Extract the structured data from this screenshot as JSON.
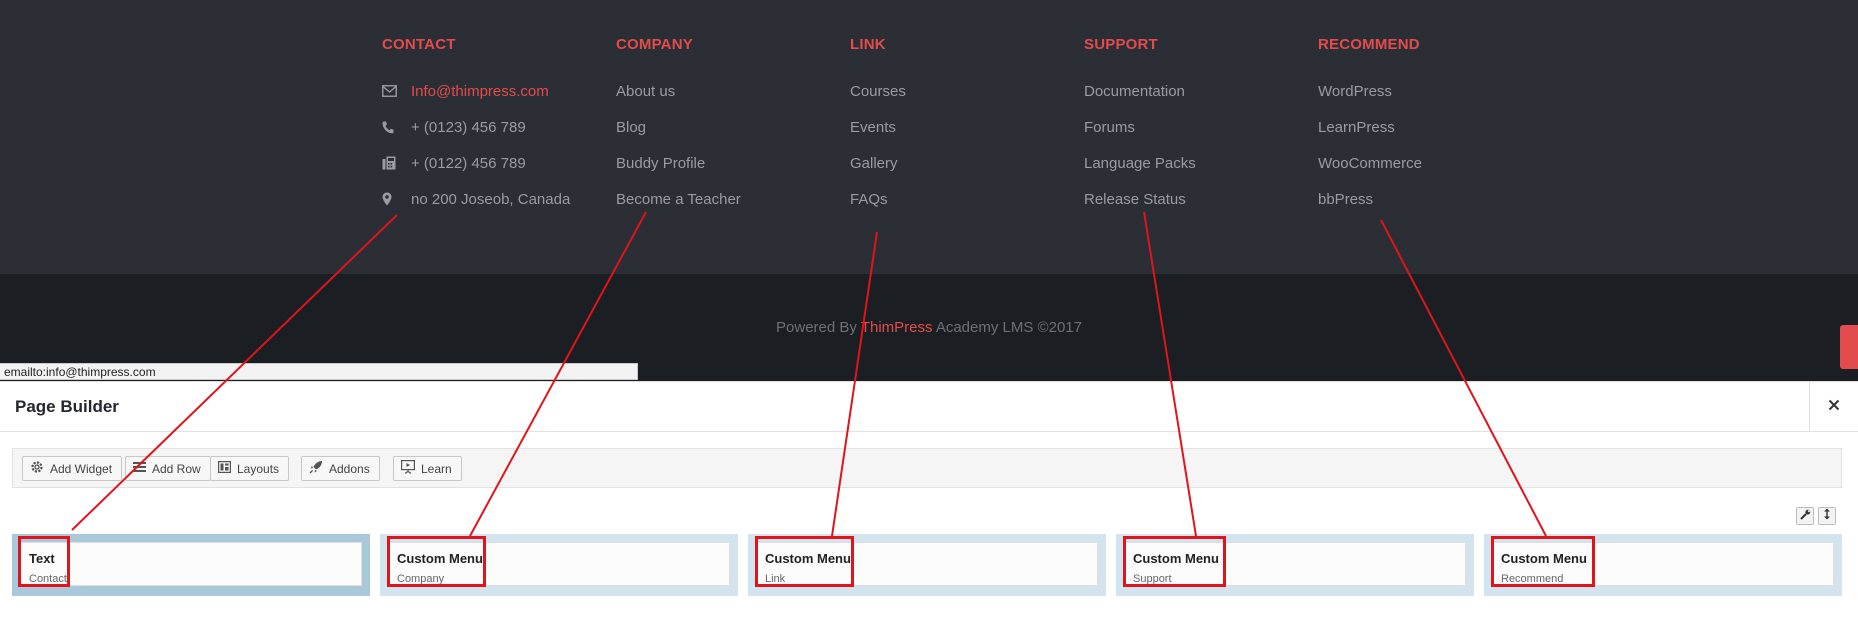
{
  "footer": {
    "columns": [
      {
        "heading": "CONTACT",
        "items": [
          {
            "label": "Info@thimpress.com",
            "icon": "envelope-icon",
            "accent": true
          },
          {
            "label": "+ (0123) 456 789",
            "icon": "phone-icon"
          },
          {
            "label": "+ (0122) 456 789",
            "icon": "fax-icon"
          },
          {
            "label": "no 200 Joseob, Canada",
            "icon": "map-marker-icon"
          }
        ]
      },
      {
        "heading": "COMPANY",
        "items": [
          {
            "label": "About us"
          },
          {
            "label": "Blog"
          },
          {
            "label": "Buddy Profile"
          },
          {
            "label": "Become a Teacher"
          }
        ]
      },
      {
        "heading": "LINK",
        "items": [
          {
            "label": "Courses"
          },
          {
            "label": "Events"
          },
          {
            "label": "Gallery"
          },
          {
            "label": "FAQs"
          }
        ]
      },
      {
        "heading": "SUPPORT",
        "items": [
          {
            "label": "Documentation"
          },
          {
            "label": "Forums"
          },
          {
            "label": "Language Packs"
          },
          {
            "label": "Release Status"
          }
        ]
      },
      {
        "heading": "RECOMMEND",
        "items": [
          {
            "label": "WordPress"
          },
          {
            "label": "LearnPress"
          },
          {
            "label": "WooCommerce"
          },
          {
            "label": "bbPress"
          }
        ]
      }
    ],
    "copyright": {
      "prefix": "Powered By ",
      "brand": "ThimPress",
      "suffix": " Academy LMS ©2017"
    }
  },
  "status_bar": {
    "url": "emailto:info@thimpress.com"
  },
  "page_builder": {
    "title": "Page Builder",
    "close_icon": "close-icon",
    "toolbar": [
      {
        "label": "Add Widget",
        "icon": "gear-icon"
      },
      {
        "label": "Add Row",
        "icon": "rows-icon"
      },
      {
        "label": "Layouts",
        "icon": "layout-icon"
      },
      {
        "label": "Addons",
        "icon": "rocket-icon"
      },
      {
        "label": "Learn",
        "icon": "presentation-icon"
      }
    ],
    "row_controls": [
      {
        "icon": "wrench-icon"
      },
      {
        "icon": "move-icon"
      }
    ],
    "cells": [
      {
        "title": "Text",
        "subtitle": "Contact",
        "active": true
      },
      {
        "title": "Custom Menu",
        "subtitle": "Company"
      },
      {
        "title": "Custom Menu",
        "subtitle": "Link"
      },
      {
        "title": "Custom Menu",
        "subtitle": "Support"
      },
      {
        "title": "Custom Menu",
        "subtitle": "Recommend"
      }
    ]
  },
  "colors": {
    "accent": "#e34c4c",
    "footer_bg": "#2b2e35",
    "footer_bottom_bg": "#1b1e22",
    "annotation": "#e0141c",
    "cell_bg": "#d3e4ee",
    "cell_active_bg": "#a9c9db"
  }
}
